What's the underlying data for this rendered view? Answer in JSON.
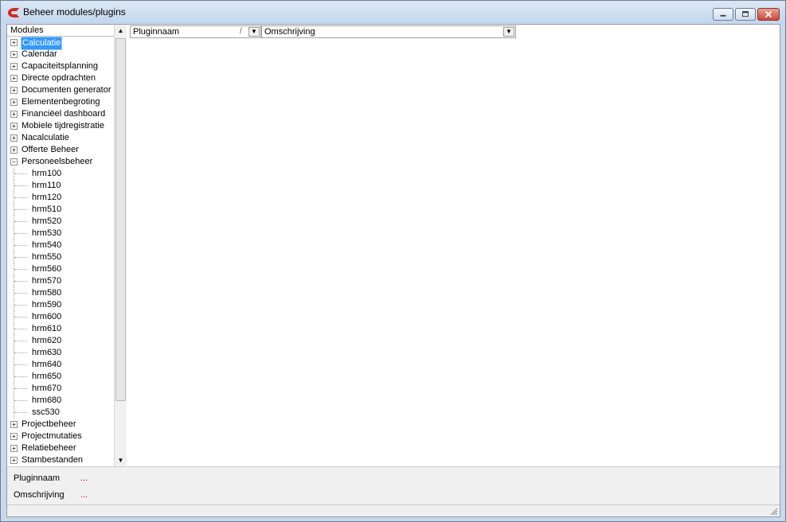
{
  "window": {
    "title": "Beheer modules/plugins",
    "accent_color": "#3399ff",
    "close_color": "#c9473a",
    "icons": [
      "app-logo-icon",
      "minimize-icon",
      "maximize-icon",
      "close-icon"
    ]
  },
  "tree": {
    "header": "Modules",
    "items": [
      {
        "label": "Calculatie",
        "expander": "+",
        "selected": true
      },
      {
        "label": "Calendar",
        "expander": "+"
      },
      {
        "label": "Capaciteitsplanning",
        "expander": "+"
      },
      {
        "label": "Directe opdrachten",
        "expander": "+"
      },
      {
        "label": "Documenten generator",
        "expander": "+"
      },
      {
        "label": "Elementenbegroting",
        "expander": "+"
      },
      {
        "label": "Financiëel dashboard",
        "expander": "+"
      },
      {
        "label": "Mobiele tijdregistratie",
        "expander": "+"
      },
      {
        "label": "Nacalculatie",
        "expander": "+"
      },
      {
        "label": "Offerte Beheer",
        "expander": "+"
      },
      {
        "label": "Personeelsbeheer",
        "expander": "−",
        "expanded": true
      },
      {
        "label": "hrm100",
        "child": true
      },
      {
        "label": "hrm110",
        "child": true
      },
      {
        "label": "hrm120",
        "child": true
      },
      {
        "label": "hrm510",
        "child": true
      },
      {
        "label": "hrm520",
        "child": true
      },
      {
        "label": "hrm530",
        "child": true
      },
      {
        "label": "hrm540",
        "child": true
      },
      {
        "label": "hrm550",
        "child": true
      },
      {
        "label": "hrm560",
        "child": true
      },
      {
        "label": "hrm570",
        "child": true
      },
      {
        "label": "hrm580",
        "child": true
      },
      {
        "label": "hrm590",
        "child": true
      },
      {
        "label": "hrm600",
        "child": true
      },
      {
        "label": "hrm610",
        "child": true
      },
      {
        "label": "hrm620",
        "child": true
      },
      {
        "label": "hrm630",
        "child": true
      },
      {
        "label": "hrm640",
        "child": true
      },
      {
        "label": "hrm650",
        "child": true
      },
      {
        "label": "hrm670",
        "child": true
      },
      {
        "label": "hrm680",
        "child": true
      },
      {
        "label": "ssc530",
        "child": true
      },
      {
        "label": "Projectbeheer",
        "expander": "+"
      },
      {
        "label": "Projectmutaties",
        "expander": "+"
      },
      {
        "label": "Relatiebeheer",
        "expander": "+"
      },
      {
        "label": "Stambestanden",
        "expander": "+"
      }
    ]
  },
  "grid": {
    "columns": [
      {
        "label": "Pluginnaam",
        "sort_indicator": "/",
        "dropdown": "▼"
      },
      {
        "label": "Omschrijving",
        "dropdown": "▼"
      }
    ]
  },
  "filter": {
    "fields": [
      {
        "label": "Pluginnaam",
        "value": "..."
      },
      {
        "label": "Omschrijving",
        "value": "..."
      }
    ]
  },
  "scrollbar": {
    "up": "▲",
    "down": "▼"
  }
}
